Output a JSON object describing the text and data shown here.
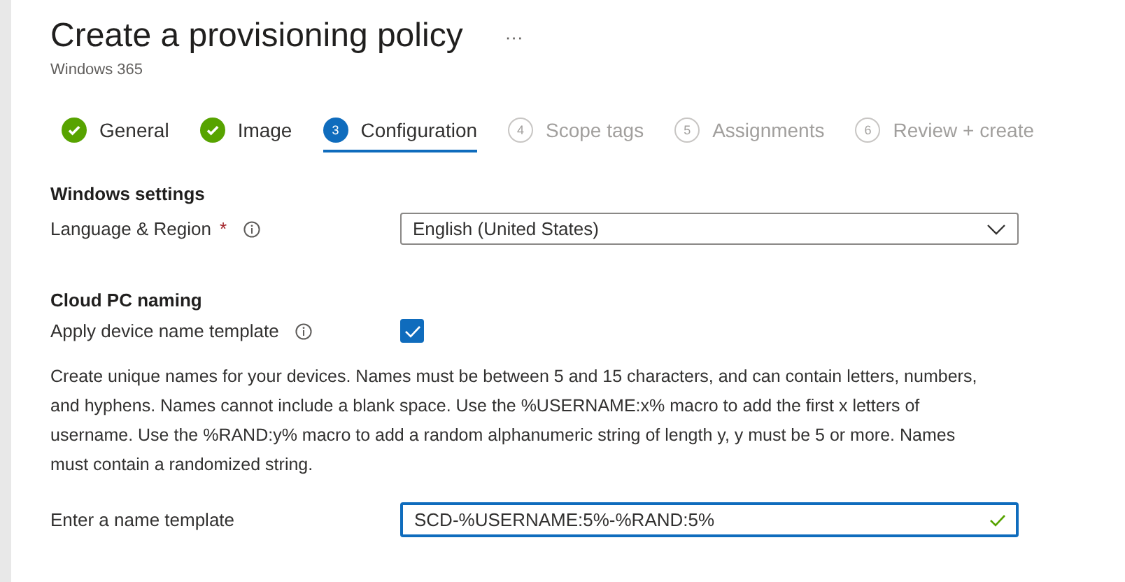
{
  "header": {
    "title": "Create a provisioning policy",
    "more": "···",
    "subtitle": "Windows 365"
  },
  "steps": [
    {
      "kind": "done",
      "label": "General",
      "selected": false
    },
    {
      "kind": "done",
      "label": "Image",
      "selected": false
    },
    {
      "kind": "current",
      "number": "3",
      "label": "Configuration",
      "selected": true
    },
    {
      "kind": "pending",
      "number": "4",
      "label": "Scope tags",
      "selected": false
    },
    {
      "kind": "pending",
      "number": "5",
      "label": "Assignments",
      "selected": false
    },
    {
      "kind": "pending",
      "number": "6",
      "label": "Review + create",
      "selected": false
    }
  ],
  "windows_settings": {
    "heading": "Windows settings",
    "language": {
      "label": "Language & Region",
      "required_mark": "*",
      "value": "English (United States)"
    }
  },
  "cloud_pc_naming": {
    "heading": "Cloud PC naming",
    "apply_template": {
      "label": "Apply device name template",
      "checked": true
    },
    "description": "Create unique names for your devices. Names must be between 5 and 15 characters, and can contain letters, numbers, and hyphens. Names cannot include a blank space. Use the %USERNAME:x% macro to add the first x letters of username. Use the %RAND:y% macro to add a random alphanumeric string of length y, y must be 5 or more. Names must contain a randomized string.",
    "name_template": {
      "label": "Enter a name template",
      "value": "SCD-%USERNAME:5%-%RAND:5%",
      "valid": true
    }
  }
}
